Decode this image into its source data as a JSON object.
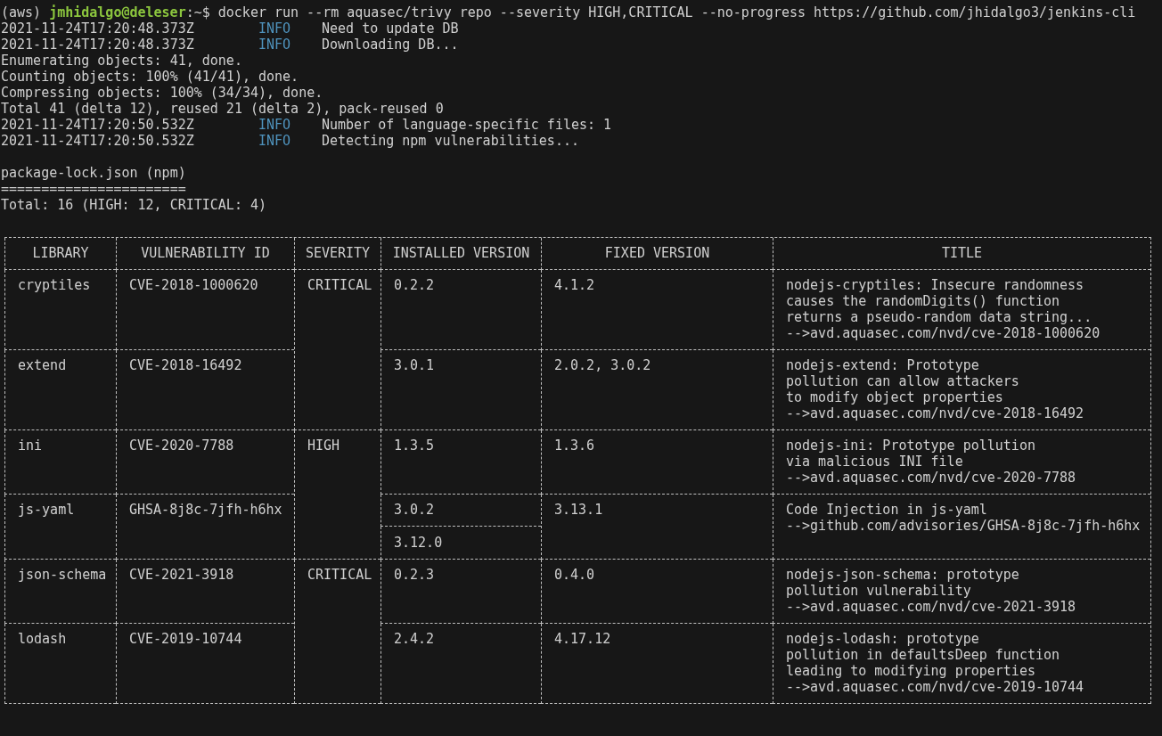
{
  "prompt": {
    "env": "(aws)",
    "user_host": "jmhidalgo@deleser",
    "cwd": ":~$",
    "command": "docker run --rm aquasec/trivy repo --severity HIGH,CRITICAL --no-progress https://github.com/jhidalgo3/jenkins-cli"
  },
  "log": [
    {
      "kind": "info",
      "time": "2021-11-24T17:20:48.373Z",
      "level": "INFO",
      "message": "Need to update DB"
    },
    {
      "kind": "info",
      "time": "2021-11-24T17:20:48.373Z",
      "level": "INFO",
      "message": "Downloading DB..."
    },
    {
      "kind": "plain",
      "text": "Enumerating objects: 41, done."
    },
    {
      "kind": "plain",
      "text": "Counting objects: 100% (41/41), done."
    },
    {
      "kind": "plain",
      "text": "Compressing objects: 100% (34/34), done."
    },
    {
      "kind": "plain",
      "text": "Total 41 (delta 12), reused 21 (delta 2), pack-reused 0"
    },
    {
      "kind": "info",
      "time": "2021-11-24T17:20:50.532Z",
      "level": "INFO",
      "message": "Number of language-specific files: 1"
    },
    {
      "kind": "info",
      "time": "2021-11-24T17:20:50.532Z",
      "level": "INFO",
      "message": "Detecting npm vulnerabilities..."
    }
  ],
  "report": {
    "target": "package-lock.json (npm)",
    "underline": "=======================",
    "total": "Total: 16 (HIGH: 12, CRITICAL: 4)"
  },
  "table": {
    "columns": [
      "LIBRARY",
      "VULNERABILITY ID",
      "SEVERITY",
      "INSTALLED VERSION",
      "FIXED VERSION",
      "TITLE"
    ],
    "severity_groups": [
      {
        "severity": "CRITICAL",
        "rows": [
          {
            "library": "cryptiles",
            "vulnerability_id": "CVE-2018-1000620",
            "installed_versions": [
              "0.2.2"
            ],
            "fixed_version": "4.1.2",
            "title_lines": [
              "nodejs-cryptiles: Insecure randomness",
              "causes the randomDigits() function",
              "returns a pseudo-random data string..."
            ],
            "link": "-->avd.aquasec.com/nvd/cve-2018-1000620"
          },
          {
            "library": "extend",
            "vulnerability_id": "CVE-2018-16492",
            "installed_versions": [
              "3.0.1"
            ],
            "fixed_version": "2.0.2, 3.0.2",
            "title_lines": [
              "nodejs-extend: Prototype",
              "pollution can allow attackers",
              "to modify object properties"
            ],
            "link": "-->avd.aquasec.com/nvd/cve-2018-16492"
          }
        ]
      },
      {
        "severity": "HIGH",
        "rows": [
          {
            "library": "ini",
            "vulnerability_id": "CVE-2020-7788",
            "installed_versions": [
              "1.3.5"
            ],
            "fixed_version": "1.3.6",
            "title_lines": [
              "nodejs-ini: Prototype pollution",
              "via malicious INI file"
            ],
            "link": "-->avd.aquasec.com/nvd/cve-2020-7788"
          },
          {
            "library": "js-yaml",
            "vulnerability_id": "GHSA-8j8c-7jfh-h6hx",
            "installed_versions": [
              "3.0.2",
              "3.12.0"
            ],
            "fixed_version": "3.13.1",
            "title_lines": [
              "Code Injection in js-yaml"
            ],
            "link": "-->github.com/advisories/GHSA-8j8c-7jfh-h6hx"
          }
        ]
      },
      {
        "severity": "CRITICAL",
        "rows": [
          {
            "library": "json-schema",
            "vulnerability_id": "CVE-2021-3918",
            "installed_versions": [
              "0.2.3"
            ],
            "fixed_version": "0.4.0",
            "title_lines": [
              "nodejs-json-schema: prototype",
              "pollution vulnerability"
            ],
            "link": "-->avd.aquasec.com/nvd/cve-2021-3918"
          },
          {
            "library": "lodash",
            "vulnerability_id": "CVE-2019-10744",
            "installed_versions": [
              "2.4.2"
            ],
            "fixed_version": "4.17.12",
            "title_lines": [
              "nodejs-lodash: prototype",
              "pollution in defaultsDeep function",
              "leading to modifying properties"
            ],
            "link": "-->avd.aquasec.com/nvd/cve-2019-10744"
          }
        ]
      }
    ]
  }
}
